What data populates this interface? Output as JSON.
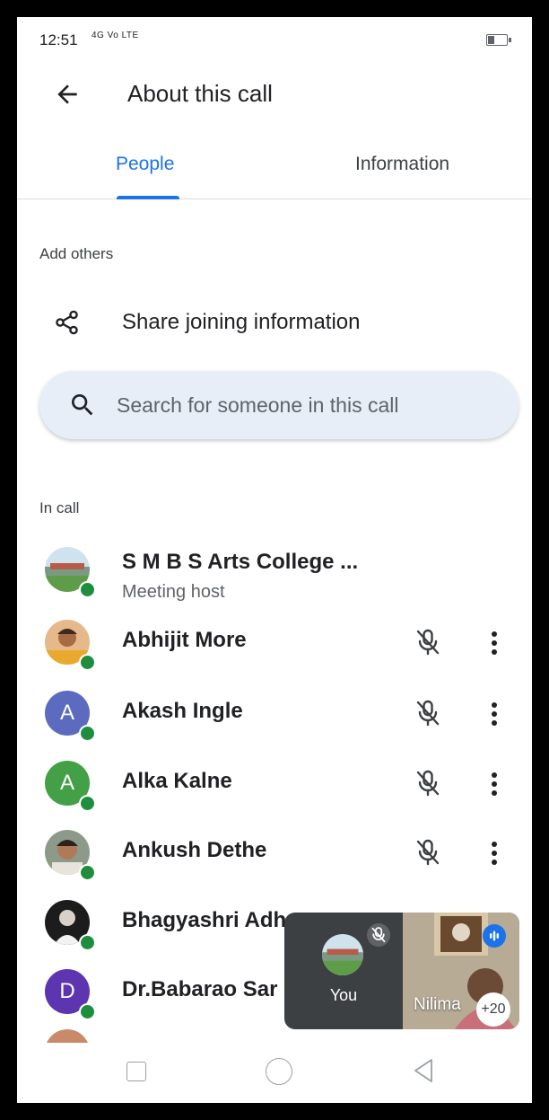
{
  "status_bar": {
    "time": "12:51",
    "network": "4G Vo LTE",
    "battery_level": 0.35
  },
  "header": {
    "title": "About this call",
    "back_icon": "arrow-back-icon"
  },
  "tabs": [
    {
      "label": "People",
      "selected": true
    },
    {
      "label": "Information",
      "selected": false
    }
  ],
  "add_others": {
    "section_label": "Add others",
    "share_label": "Share joining information",
    "share_icon": "share-icon"
  },
  "search": {
    "placeholder": "Search for someone in this call",
    "icon": "search-icon"
  },
  "in_call": {
    "section_label": "In call",
    "participants": [
      {
        "name": "S M B S Arts College ...",
        "subtitle": "Meeting host",
        "avatar": "photo",
        "online": true,
        "muted": false
      },
      {
        "name": "Abhijit More",
        "avatar": "photo",
        "online": true,
        "muted": true
      },
      {
        "name": "Akash Ingle",
        "avatar_letter": "A",
        "avatar_color": "#5c6bc0",
        "online": true,
        "muted": true
      },
      {
        "name": "Alka Kalne",
        "avatar_letter": "A",
        "avatar_color": "#43a047",
        "online": true,
        "muted": true
      },
      {
        "name": "Ankush Dethe",
        "avatar": "photo",
        "online": true,
        "muted": true
      },
      {
        "name": "Bhagyashri Adh",
        "avatar": "photo",
        "online": true,
        "muted": true
      },
      {
        "name": "Dr.Babarao Sar",
        "avatar_letter": "D",
        "avatar_color": "#5e35b1",
        "online": true,
        "muted": true
      }
    ]
  },
  "pip": {
    "self_label": "You",
    "other_label": "Nilima",
    "more_count": "+20"
  },
  "nav": {
    "recents": "square-icon",
    "home": "circle-icon",
    "back": "triangle-back-icon"
  },
  "colors": {
    "accent": "#1a73e8",
    "online": "#1e8e3e",
    "search_bg": "#e8eef8"
  }
}
